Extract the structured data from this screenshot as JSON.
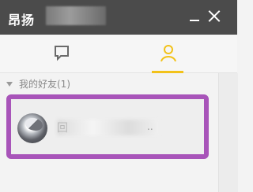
{
  "window": {
    "title": "昂扬",
    "minimize_icon": "minimize-icon",
    "close_icon": "close-icon"
  },
  "tabs": [
    {
      "name": "messages",
      "icon": "chat-bubble-icon",
      "active": false
    },
    {
      "name": "contacts",
      "icon": "user-icon",
      "active": true
    }
  ],
  "colors": {
    "titlebar": "#4b4b4b",
    "active_tab": "#f2c21a",
    "highlight_border": "#a854b9"
  },
  "group": {
    "label": "我的好友(1)"
  },
  "friend": {
    "name_visible": "回",
    "ellipsis": ".."
  }
}
